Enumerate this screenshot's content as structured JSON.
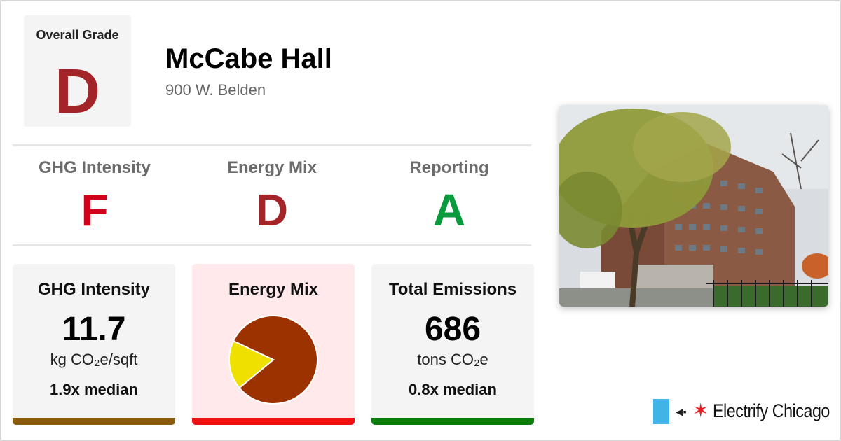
{
  "overall": {
    "label": "Overall Grade",
    "grade": "D"
  },
  "building": {
    "name": "McCabe Hall",
    "address": "900 W. Belden"
  },
  "grades": [
    {
      "label": "GHG Intensity",
      "grade": "F",
      "color": "#d0021b"
    },
    {
      "label": "Energy Mix",
      "grade": "D",
      "color": "#a3252a"
    },
    {
      "label": "Reporting",
      "grade": "A",
      "color": "#0a9a3e"
    }
  ],
  "cards": {
    "ghg": {
      "title": "GHG Intensity",
      "value": "11.7",
      "unit": "kg CO₂e/sqft",
      "median": "1.9x median",
      "bar_color": "#8b5a0b"
    },
    "energy_mix": {
      "title": "Energy Mix",
      "bar_color": "#ee1111",
      "background": "#ffe9ea"
    },
    "emissions": {
      "title": "Total Emissions",
      "value": "686",
      "unit": "tons CO₂e",
      "median": "0.8x median",
      "bar_color": "#0a7c0a"
    }
  },
  "chart_data": {
    "type": "pie",
    "slices": [
      {
        "value": 82,
        "color": "#9b3200"
      },
      {
        "value": 18,
        "color": "#f0e000"
      }
    ]
  },
  "brand": {
    "name": "Electrify Chicago",
    "icon": "plug-icon",
    "star_icon": "red-star-icon",
    "flag_color": "#40b4e5"
  }
}
